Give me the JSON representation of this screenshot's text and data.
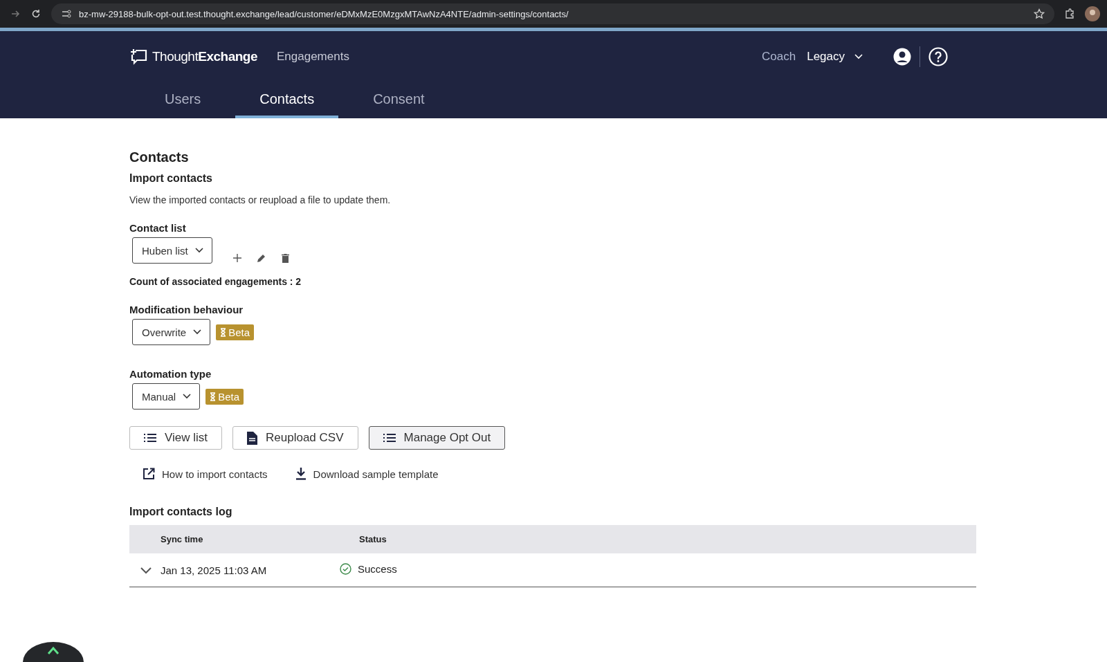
{
  "browser": {
    "url": "bz-mw-29188-bulk-opt-out.test.thought.exchange/lead/customer/eDMxMzE0MzgxMTAwNzA4NTE/admin-settings/contacts/"
  },
  "header": {
    "logo": "Thought**Exchange**",
    "nav": [
      {
        "label": "Engagements"
      }
    ],
    "coach": "Coach",
    "legacy": "Legacy"
  },
  "tabs": [
    {
      "label": "Users",
      "selected": false
    },
    {
      "label": "Contacts",
      "selected": true
    },
    {
      "label": "Consent",
      "selected": false
    }
  ],
  "page": {
    "title": "Contacts",
    "section": "Import contacts",
    "description": "View the imported contacts or reupload a file to update them.",
    "contact_list": {
      "label": "Contact list",
      "value": "Huben list"
    },
    "count": "Count of associated engagements : 2",
    "modification": {
      "label": "Modification behaviour",
      "value": "Overwrite",
      "badge": "Beta"
    },
    "automation": {
      "label": "Automation type",
      "value": "Manual",
      "badge": "Beta"
    },
    "buttons": [
      {
        "label": "View list",
        "kind": "list",
        "hovered": false
      },
      {
        "label": "Reupload CSV",
        "kind": "file",
        "hovered": false
      },
      {
        "label": "Manage Opt Out",
        "kind": "list",
        "hovered": true
      }
    ],
    "links": [
      {
        "label": "How to import contacts",
        "kind": "external"
      },
      {
        "label": "Download sample template",
        "kind": "download"
      }
    ],
    "log": {
      "title": "Import contacts log",
      "columns": [
        "Sync time",
        "Status"
      ],
      "rows": [
        {
          "sync_time": "Jan 13, 2025 11:03 AM",
          "status": "Success",
          "expanded": false
        }
      ]
    }
  }
}
